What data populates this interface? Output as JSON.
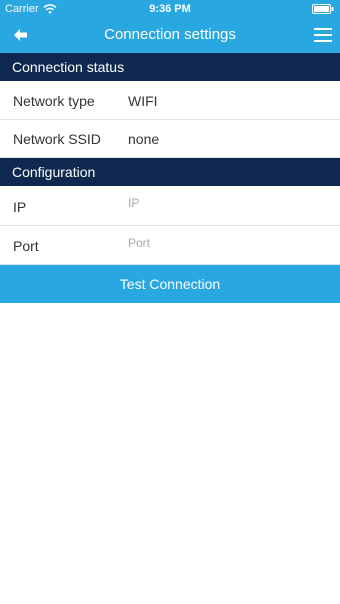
{
  "status_bar": {
    "carrier": "Carrier",
    "time": "9:36 PM"
  },
  "nav": {
    "title": "Connection settings",
    "back_icon": "arrow-left-icon",
    "menu_icon": "hamburger-menu-icon"
  },
  "connection_status": {
    "header": "Connection status",
    "rows": [
      {
        "label": "Network type",
        "value": "WIFI"
      },
      {
        "label": "Network SSID",
        "value": "none"
      }
    ]
  },
  "configuration": {
    "header": "Configuration",
    "ip": {
      "label": "IP",
      "value": "",
      "placeholder": "IP"
    },
    "port": {
      "label": "Port",
      "value": "",
      "placeholder": "Port"
    }
  },
  "actions": {
    "test_connection_label": "Test Connection"
  },
  "colors": {
    "accent": "#29a7e1",
    "section_header": "#0e2850",
    "divider": "#e1e1e1",
    "placeholder": "#a8a8a8"
  }
}
